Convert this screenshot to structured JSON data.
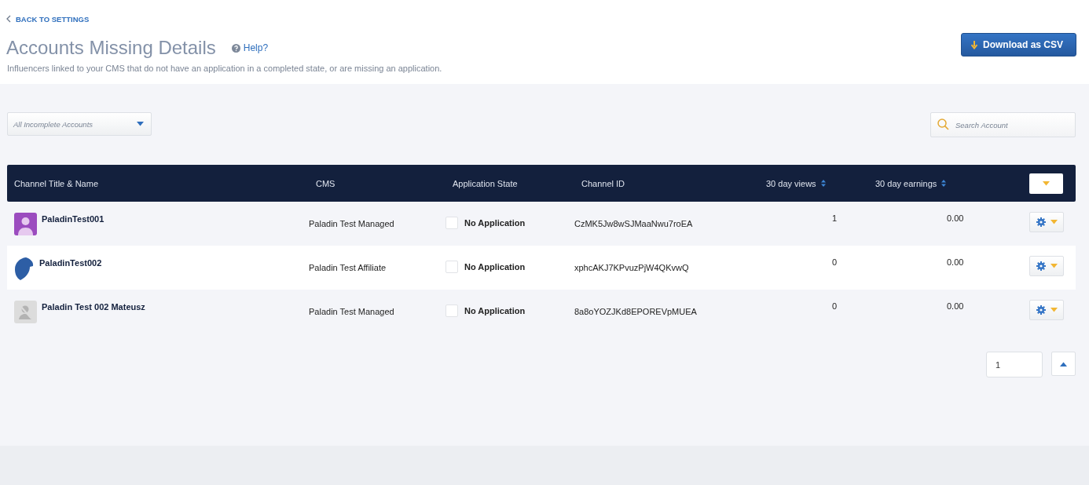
{
  "back_link": "BACK TO SETTINGS",
  "page": {
    "title": "Accounts Missing Details",
    "help": "Help?",
    "description": "Influencers linked to your CMS that do not have an application in a completed state, or are missing an application."
  },
  "download_button": "Download as CSV",
  "filter": {
    "value": "All Incomplete Accounts"
  },
  "search": {
    "placeholder": "Search Account"
  },
  "table": {
    "columns": [
      {
        "label": "Channel Title & Name",
        "sortable": false
      },
      {
        "label": "CMS",
        "sortable": false
      },
      {
        "label": "Application State",
        "sortable": false
      },
      {
        "label": "Channel ID",
        "sortable": false
      },
      {
        "label": "30 day views",
        "sortable": true
      },
      {
        "label": "30 day earnings",
        "sortable": true
      }
    ],
    "rows": [
      {
        "kind": "person",
        "name": "PaladinTest001",
        "cms": "Paladin Test Managed",
        "checked": false,
        "state": "No Application",
        "channel_id": "CzMK5Jw8wSJMaaNwu7roEA",
        "views": "1",
        "earnings": "0.00"
      },
      {
        "kind": "logo",
        "name": "PaladinTest002",
        "cms": "Paladin Test Affiliate",
        "checked": false,
        "state": "No Application",
        "channel_id": "xphcAKJ7KPvuzPjW4QKvwQ",
        "views": "0",
        "earnings": "0.00"
      },
      {
        "kind": "placeholder",
        "name": "Paladin Test 002 Mateusz",
        "cms": "Paladin Test Managed",
        "checked": false,
        "state": "No Application",
        "channel_id": "8a8oYOZJKd8EPOREVpMUEA",
        "views": "0",
        "earnings": "0.00"
      }
    ]
  },
  "pagination": {
    "page": "1"
  }
}
